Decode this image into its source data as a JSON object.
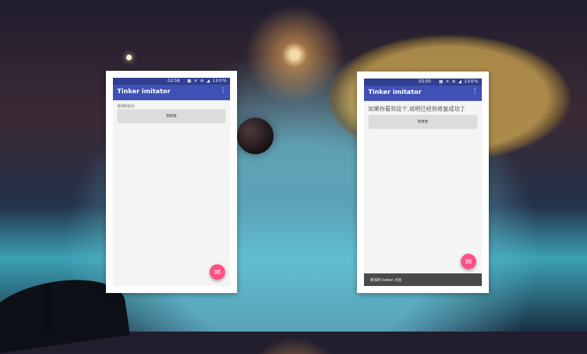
{
  "left_phone": {
    "status": {
      "time": "02:58",
      "icons_text": "▦ ✕ ⊛ ◢ 100%"
    },
    "toolbar": {
      "title": "Tinker imitator",
      "menu_icon": "overflow-menu-icon"
    },
    "label": "错误的显示",
    "hot_button_label": "热修复",
    "fab_icon": "email-icon"
  },
  "right_phone": {
    "status": {
      "time": "03:00",
      "icons_text": "▦ ✕ ⊛ ◢ 100%"
    },
    "toolbar": {
      "title": "Tinker imitator",
      "menu_icon": "overflow-menu-icon"
    },
    "label": "如果你看到这个,说明已经热修复成功了",
    "hot_button_label": "热修复",
    "fab_icon": "email-icon",
    "snackbar_text": "新加的 button 点击"
  },
  "colors": {
    "toolbar": "#3f51b5",
    "statusbar": "#2f3f8f",
    "fab": "#ff4f86",
    "snackbar": "#4a4a4a"
  }
}
